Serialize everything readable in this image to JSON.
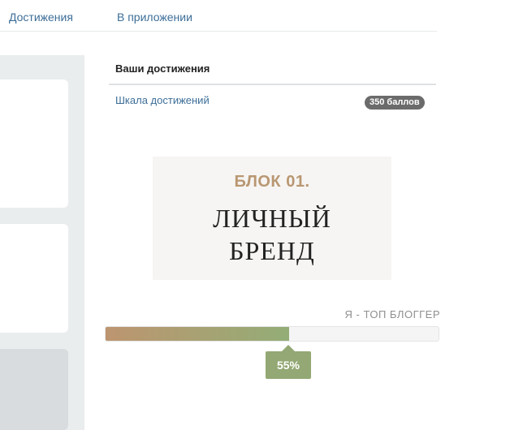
{
  "tabs": [
    {
      "label": "Достижения"
    },
    {
      "label": "В приложении"
    }
  ],
  "achievements": {
    "title": "Ваши достижения",
    "scale_link": "Шкала достижений",
    "points_badge": "350 баллов"
  },
  "block": {
    "label": "БЛОК 01.",
    "title_line1": "ЛИЧНЫЙ",
    "title_line2": "БРЕНД"
  },
  "progress": {
    "label": "Я - ТОП БЛОГГЕР",
    "percent": 55,
    "percent_text": "55%"
  },
  "colors": {
    "link": "#3d6e98",
    "accent_gold": "#b99772",
    "progress_start": "#bd9570",
    "progress_end": "#93ad76"
  }
}
